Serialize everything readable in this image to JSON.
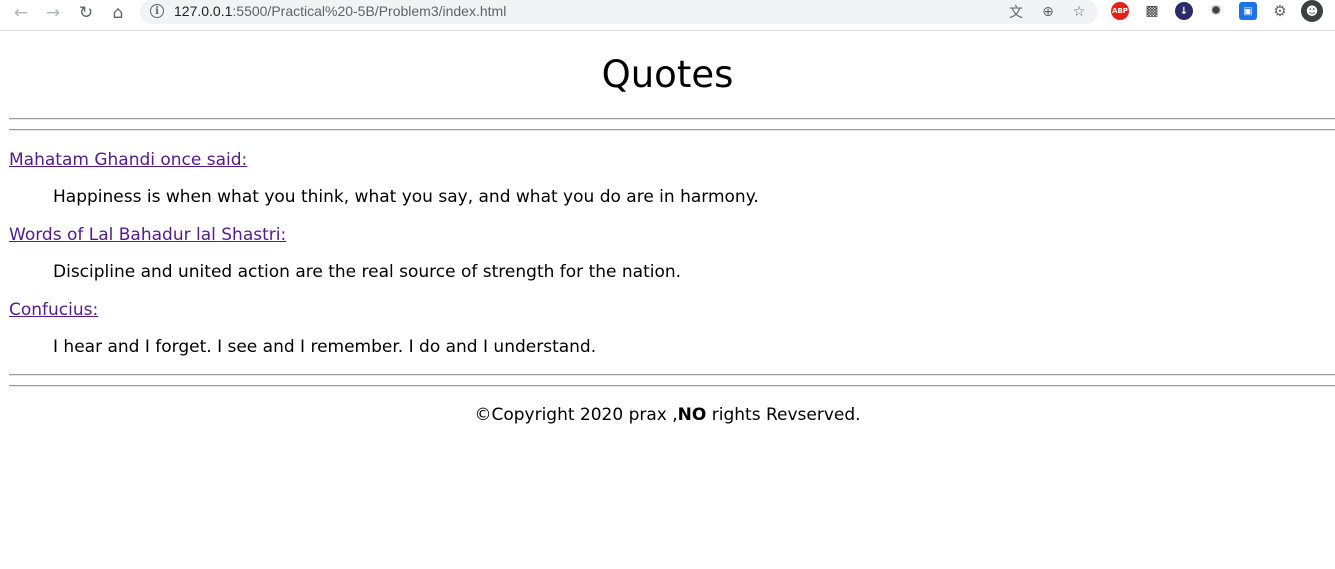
{
  "browser": {
    "url_host": "127.0.0.1",
    "url_rest": ":5500/Practical%20-5B/Problem3/index.html",
    "extensions": [
      "ABP"
    ]
  },
  "page": {
    "title": "Quotes",
    "quotes": [
      {
        "author": "Mahatam Ghandi once said:",
        "text": "Happiness is when what you think, what you say, and what you do are in harmony."
      },
      {
        "author": "Words of Lal Bahadur lal Shastri:",
        "text": "Discipline and united action are the real source of strength for the nation."
      },
      {
        "author": "Confucius:",
        "text": "I hear and I forget. I see and I remember. I do and I understand."
      }
    ],
    "footer": {
      "prefix": "©Copyright 2020 prax ,",
      "bold": "NO",
      "suffix": " rights Revserved."
    }
  },
  "colors": {
    "link_visited": "#551a8b",
    "toolbar_bg": "#ffffff",
    "omnibox_bg": "#f1f3f4"
  }
}
